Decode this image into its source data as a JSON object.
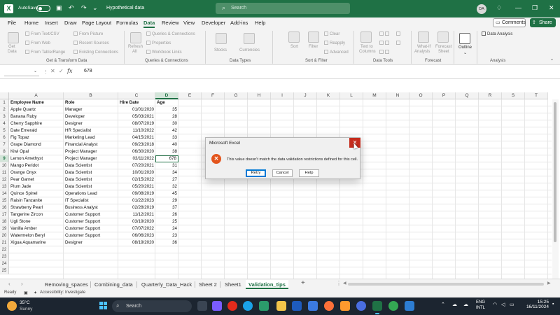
{
  "titlebar": {
    "autosave_label": "AutoSave",
    "autosave_state": "Off",
    "doc_title": "Hypothetical data",
    "search_placeholder": "Search",
    "user_initials": "DA"
  },
  "menu": {
    "tabs": [
      "File",
      "Home",
      "Insert",
      "Draw",
      "Page Layout",
      "Formulas",
      "Data",
      "Review",
      "View",
      "Developer",
      "Add-ins",
      "Help"
    ],
    "active_tab": "Data",
    "comments_label": "Comments",
    "share_label": "Share"
  },
  "ribbon": {
    "get_data": {
      "label1": "Get",
      "label2": "Data"
    },
    "get_transform_items": [
      "From Text/CSV",
      "From Web",
      "From Table/Range",
      "From Picture",
      "Recent Sources",
      "Existing Connections"
    ],
    "refresh": {
      "label1": "Refresh",
      "label2": "All"
    },
    "queries_items": [
      "Queries & Connections",
      "Properties",
      "Workbook Links"
    ],
    "data_types": [
      "Stocks",
      "Currencies"
    ],
    "sort_items": [
      "Sort",
      "Filter",
      "Clear",
      "Reapply",
      "Advanced"
    ],
    "text_to_columns": {
      "label1": "Text to",
      "label2": "Columns"
    },
    "whatif": {
      "label1": "What-If",
      "label2": "Analysis"
    },
    "forecast": {
      "label1": "Forecast",
      "label2": "Sheet"
    },
    "outline": "Outline",
    "data_analysis": "Data Analysis",
    "groups": [
      "Get & Transform Data",
      "Queries & Connections",
      "Data Types",
      "Sort & Filter",
      "Data Tools",
      "Forecast",
      "Analysis"
    ]
  },
  "formula_bar": {
    "name_box": "",
    "fx": "fx",
    "value": "678"
  },
  "grid": {
    "columns": [
      "A",
      "B",
      "C",
      "D",
      "E",
      "F",
      "G",
      "H",
      "I",
      "J",
      "K",
      "L",
      "M",
      "N",
      "O",
      "P",
      "Q",
      "R",
      "S",
      "T"
    ],
    "selected_column": "D",
    "selected_row": 9,
    "row_numbers": [
      "1",
      "2",
      "3",
      "4",
      "5",
      "6",
      "7",
      "8",
      "9",
      "10",
      "11",
      "12",
      "13",
      "14",
      "15",
      "16",
      "17",
      "18",
      "19",
      "20",
      "21",
      "22",
      "23",
      "24",
      "25"
    ],
    "headers": [
      "Employee Name",
      "Role",
      "Hire Date",
      "Age"
    ],
    "rows": [
      [
        "Apple Quartz",
        "Manager",
        "01/01/2020",
        "35"
      ],
      [
        "Banana Ruby",
        "Developer",
        "05/03/2021",
        "28"
      ],
      [
        "Cherry Sapphire",
        "Designer",
        "08/07/2019",
        "30"
      ],
      [
        "Date Emerald",
        "HR Specialist",
        "11/10/2022",
        "42"
      ],
      [
        "Fig Topaz",
        "Marketing Lead",
        "04/15/2021",
        "33"
      ],
      [
        "Grape Diamond",
        "Financial Analyst",
        "09/23/2018",
        "40"
      ],
      [
        "Kiwi Opal",
        "Project Manager",
        "06/30/2020",
        "38"
      ],
      [
        "Lemon Amethyst",
        "Project Manager",
        "03/11/2022",
        "678"
      ],
      [
        "Mango Peridot",
        "Data Scientist",
        "07/20/2021",
        "31"
      ],
      [
        "Orange Onyx",
        "Data Scientist",
        "10/01/2020",
        "34"
      ],
      [
        "Pear Garnet",
        "Data Scientist",
        "02/15/2022",
        "27"
      ],
      [
        "Plum Jade",
        "Data Scientist",
        "05/20/2021",
        "32"
      ],
      [
        "Quince Spinel",
        "Operations Lead",
        "09/08/2019",
        "45"
      ],
      [
        "Raisin Tanzanite",
        "IT Specialist",
        "01/22/2023",
        "29"
      ],
      [
        "Strawberry Pearl",
        "Business Analyst",
        "02/28/2019",
        "37"
      ],
      [
        "Tangerine Zircon",
        "Customer Support",
        "11/12/2021",
        "26"
      ],
      [
        "Ugli Stone",
        "Customer Support",
        "03/19/2020",
        "25"
      ],
      [
        "Vanilla Amber",
        "Customer Support",
        "07/07/2022",
        "24"
      ],
      [
        "Watermelon Beryl",
        "Customer Support",
        "06/06/2023",
        "23"
      ],
      [
        "Xigua Aquamarine",
        "Designer",
        "08/19/2020",
        "36"
      ]
    ]
  },
  "sheets": {
    "tabs": [
      "Removing_spaces",
      "Combining_data",
      "Quarterly_Data_Hack",
      "Sheet 2",
      "Sheet1",
      "Validation_tips"
    ],
    "active": "Validation_tips",
    "add": "+"
  },
  "status": {
    "ready": "Ready",
    "accessibility": "Accessibility: Investigate"
  },
  "dialog": {
    "title": "Microsoft Excel",
    "message": "This value doesn't match the data validation restrictions defined for this cell.",
    "retry": "Retry",
    "cancel": "Cancel",
    "help": "Help"
  },
  "taskbar": {
    "temperature": "35°C",
    "condition": "Sunny",
    "search": "Search",
    "lang1": "ENG",
    "lang2": "INTL",
    "time": "15:25",
    "date": "16/11/2024"
  },
  "colors": {
    "excel_green": "#1f7145",
    "dialog_error": "#e3551d",
    "close_red": "#c42b1c"
  }
}
